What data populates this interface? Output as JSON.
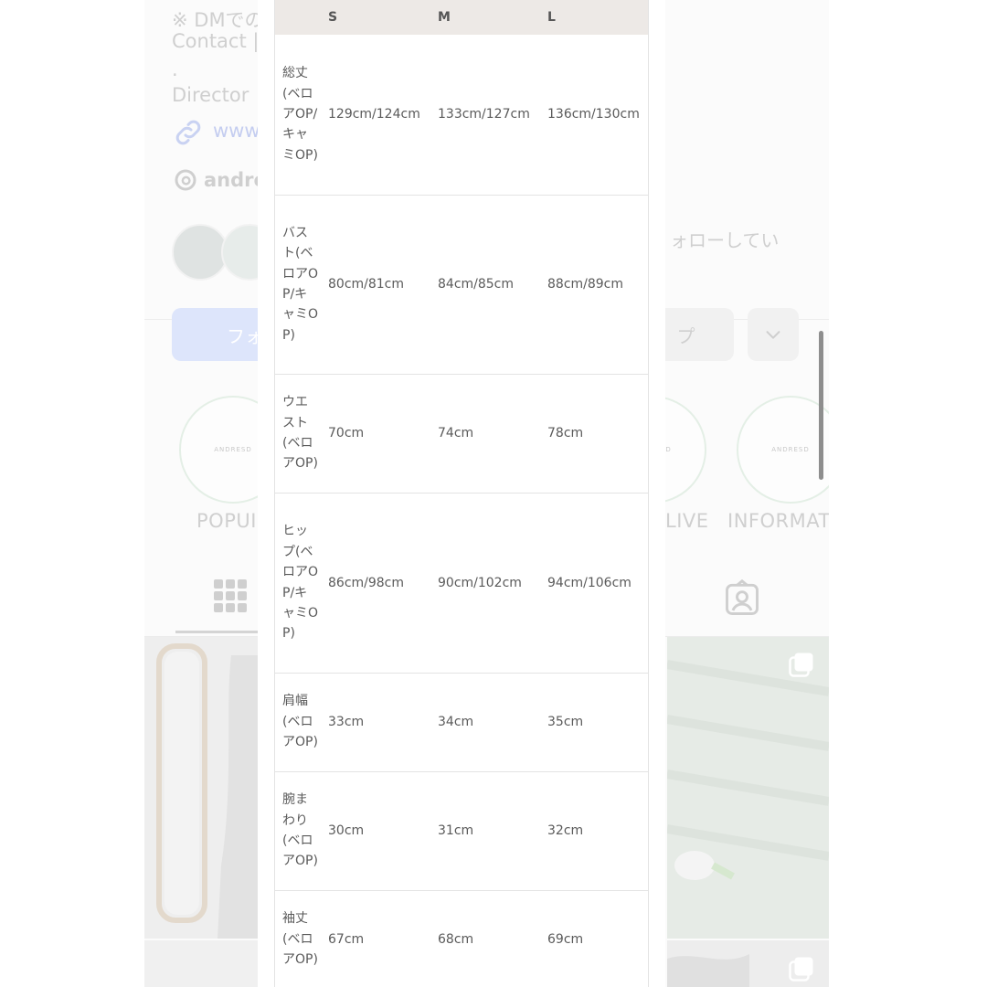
{
  "background": {
    "text_dm": "※ DMでの",
    "text_contact": "Contact |",
    "text_dot": ".",
    "text_director": "Director",
    "text_link": "www",
    "text_threads": "andre",
    "text_followed": "ォローしてい",
    "follow_button": "フォ",
    "contact_button": "プ",
    "highlights": [
      {
        "label": "POPUI",
        "logo": "ANDRESD"
      },
      {
        "label": "LIVE",
        "logo": "ANDRESD"
      },
      {
        "label": "INFORMAT",
        "logo": "ANDRESD"
      }
    ],
    "icons": [
      "link-icon",
      "threads-icon",
      "chevron-down-icon",
      "grid-icon",
      "tagged-icon",
      "multi-photo-icon"
    ]
  },
  "size_table": {
    "headers": [
      "",
      "S",
      "M",
      "L"
    ],
    "rows": [
      {
        "item": "総丈(ベロアOP/キャミOP)",
        "s": "129cm/124cm",
        "m": "133cm/127cm",
        "l": "136cm/130cm"
      },
      {
        "item": "バスト(ベロアOP/キャミOP)",
        "s": "80cm/81cm",
        "m": "84cm/85cm",
        "l": "88cm/89cm"
      },
      {
        "item": "ウエスト(ベロアOP)",
        "s": "70cm",
        "m": "74cm",
        "l": "78cm"
      },
      {
        "item": "ヒップ(ベロアOP/キャミOP)",
        "s": "86cm/98cm",
        "m": "90cm/102cm",
        "l": "94cm/106cm"
      },
      {
        "item": "肩幅(ベロアOP)",
        "s": "33cm",
        "m": "34cm",
        "l": "35cm"
      },
      {
        "item": "腕まわり(ベロアOP)",
        "s": "30cm",
        "m": "31cm",
        "l": "32cm"
      },
      {
        "item": "袖丈(ベロアOP)",
        "s": "67cm",
        "m": "68cm",
        "l": "69cm"
      }
    ]
  }
}
